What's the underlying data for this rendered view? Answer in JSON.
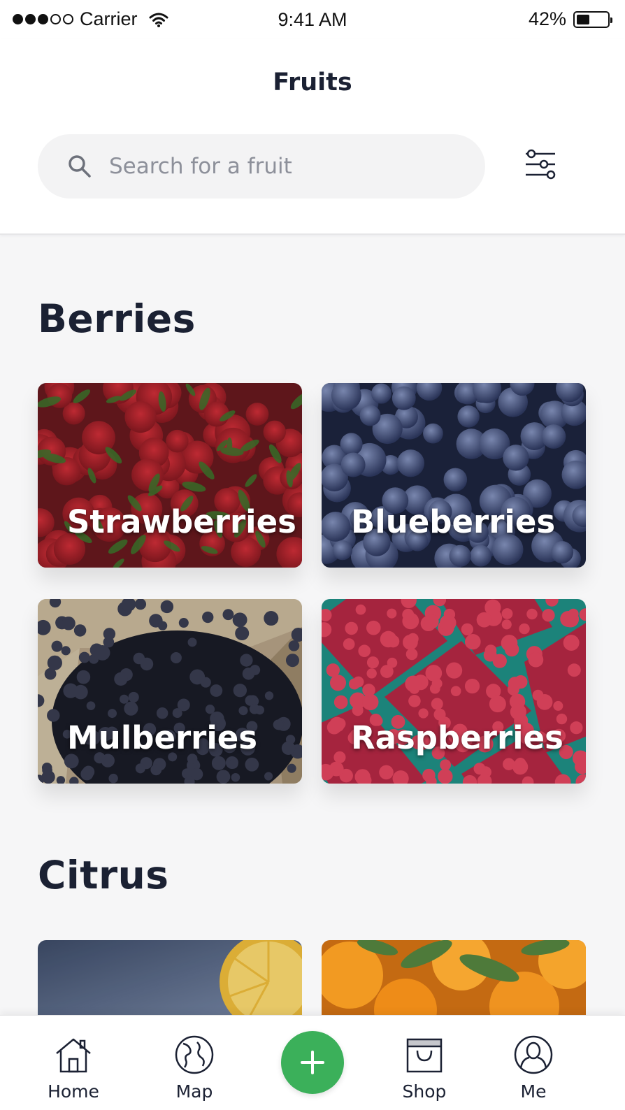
{
  "status_bar": {
    "carrier": "Carrier",
    "time": "9:41 AM",
    "battery_percent": "42%",
    "battery_level": 0.42,
    "signal_bars_filled": 3,
    "signal_bars_total": 5
  },
  "header": {
    "title": "Fruits",
    "search": {
      "placeholder": "Search for a fruit",
      "value": ""
    },
    "filter_icon": "sliders-icon"
  },
  "sections": [
    {
      "title": "Berries",
      "cards": [
        {
          "label": "Strawberries"
        },
        {
          "label": "Blueberries"
        },
        {
          "label": "Mulberries"
        },
        {
          "label": "Raspberries"
        }
      ]
    },
    {
      "title": "Citrus",
      "cards": []
    }
  ],
  "tab_bar": {
    "tabs": [
      {
        "label": "Home",
        "icon": "house-icon"
      },
      {
        "label": "Map",
        "icon": "globe-icon"
      },
      {
        "label": "Shop",
        "icon": "shopping-bag-icon"
      },
      {
        "label": "Me",
        "icon": "user-icon"
      }
    ],
    "add_icon": "plus-icon"
  },
  "colors": {
    "accent_green": "#3bb05a",
    "text_dark": "#1b2133",
    "background": "#f6f6f7",
    "search_bg": "#f3f3f4"
  }
}
